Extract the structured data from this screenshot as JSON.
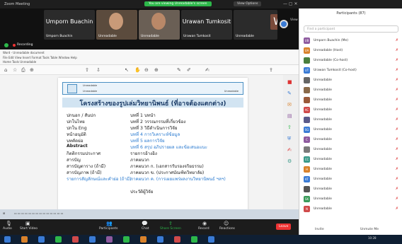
{
  "window": {
    "app_title": "Zoom Meeting",
    "share_label": "You are viewing Unreadable's screen",
    "view_options": "View Options"
  },
  "video_tiles": [
    {
      "name": "Umporn Buachin",
      "sub": "Umporn Buachin"
    },
    {
      "name": "",
      "sub": "Unreadable"
    },
    {
      "name": "",
      "sub": "Unreadable"
    },
    {
      "name": "Urawan Tumkosit",
      "sub": "Urawan Tumkosit"
    },
    {
      "name": "W",
      "sub": "Unreadable"
    }
  ],
  "view_btn": "View",
  "recording": "Recording",
  "doc": {
    "menu_line1": "Word - Unreadable document",
    "menu_line2": "File  Edit  View  Insert  Format  Tools  Table  Window  Help",
    "menu_line3": "Home  Tools  Unreadable",
    "header_line1": "Unreadable",
    "header_line2": "Unreadable",
    "header_line3": "Unreadable",
    "title": "โครงสร้างของรูปเล่มวิทยานิพนธ์ (ที่อาจต้องแตกต่าง)",
    "left_items": [
      "ปกนอก / สันปก",
      "ปกในไทย",
      "ปกใน Eng",
      "หน้าอนุมัติ",
      "บทคัดย่อ",
      "Abstract",
      "กิตติกรรมประกาศ",
      "สารบัญ",
      "สารบัญตาราง (ถ้ามี)",
      "สารบัญภาพ (ถ้ามี)",
      "รายการสัญลักษณ์และคำย่อ (ถ้ามี)"
    ],
    "right_items": [
      "บทที่ 1 บทนำ",
      "บทที่ 2 วรรณกรรมที่เกี่ยวข้อง",
      "บทที่ 3 วิธีดำเนินการวิจัย",
      "บทที่ 4 การวิเคราะห์ข้อมูล",
      "บทที่ 5 ผลการวิจัย",
      "บทที่ 6 สรุป อภิปรายผล และข้อเสนอแนะ",
      "รายการอ้างอิง",
      "ภาคผนวก",
      "ภาคผนวก ก. (เอกสารรับรองจริยธรรม)",
      "ภาคผนวก ข. (ประกาศบัณฑิตวิทยาลัย)",
      "ภาคผนวก ค. (การเผยแพร่ผลงานวิทยานิพนธ์ ฯลฯ)",
      "ประวัติผู้วิจัย"
    ]
  },
  "zoom_controls": [
    "Audio",
    "Start Video",
    "Participants",
    "Chat",
    "Share Screen",
    "Record",
    "Reactions"
  ],
  "end_button": "Leave",
  "panel": {
    "title": "Participants (87)",
    "search_placeholder": "Find a participant",
    "participants": [
      {
        "initials": "UB",
        "name": "Umporn Buachin (Me)",
        "color": "#8e5a9f"
      },
      {
        "initials": "UA",
        "name": "Unreadable (Host)",
        "color": "#d9822b"
      },
      {
        "initials": "",
        "name": "Unreadable (Co-host)",
        "color": "#4a7f3d"
      },
      {
        "initials": "UT",
        "name": "Urawan Tumkosit (Co-host)",
        "color": "#3a7bd5"
      },
      {
        "initials": "",
        "name": "Unreadable",
        "color": "#666666"
      },
      {
        "initials": "",
        "name": "Unreadable",
        "color": "#8a6a4a"
      },
      {
        "initials": "",
        "name": "Unreadable",
        "color": "#9a5a3a"
      },
      {
        "initials": "AC",
        "name": "Unreadable",
        "color": "#d04a4a"
      },
      {
        "initials": "",
        "name": "Unreadable",
        "color": "#5a5a8a"
      },
      {
        "initials": "SG",
        "name": "Unreadable",
        "color": "#3a7bd5"
      },
      {
        "initials": "C",
        "name": "Unreadable",
        "color": "#8e5a9f"
      },
      {
        "initials": "",
        "name": "Unreadable",
        "color": "#7a7a7a"
      },
      {
        "initials": "CC",
        "name": "Unreadable",
        "color": "#3a9a8a"
      },
      {
        "initials": "H",
        "name": "Unreadable",
        "color": "#d9822b"
      },
      {
        "initials": "KT",
        "name": "Unreadable",
        "color": "#3a7bd5"
      },
      {
        "initials": "",
        "name": "Unreadable",
        "color": "#555555"
      },
      {
        "initials": "SK",
        "name": "Unreadable",
        "color": "#3a9a5a"
      },
      {
        "initials": "N",
        "name": "Unreadable",
        "color": "#d04a4a"
      }
    ],
    "invite": "Invite",
    "unmute_me": "Unmute Me"
  },
  "taskbar": {
    "clock": "10:28"
  },
  "colors": {
    "accent": "#2b7bd0",
    "danger": "#dd3333",
    "share_green": "#2db84a"
  }
}
